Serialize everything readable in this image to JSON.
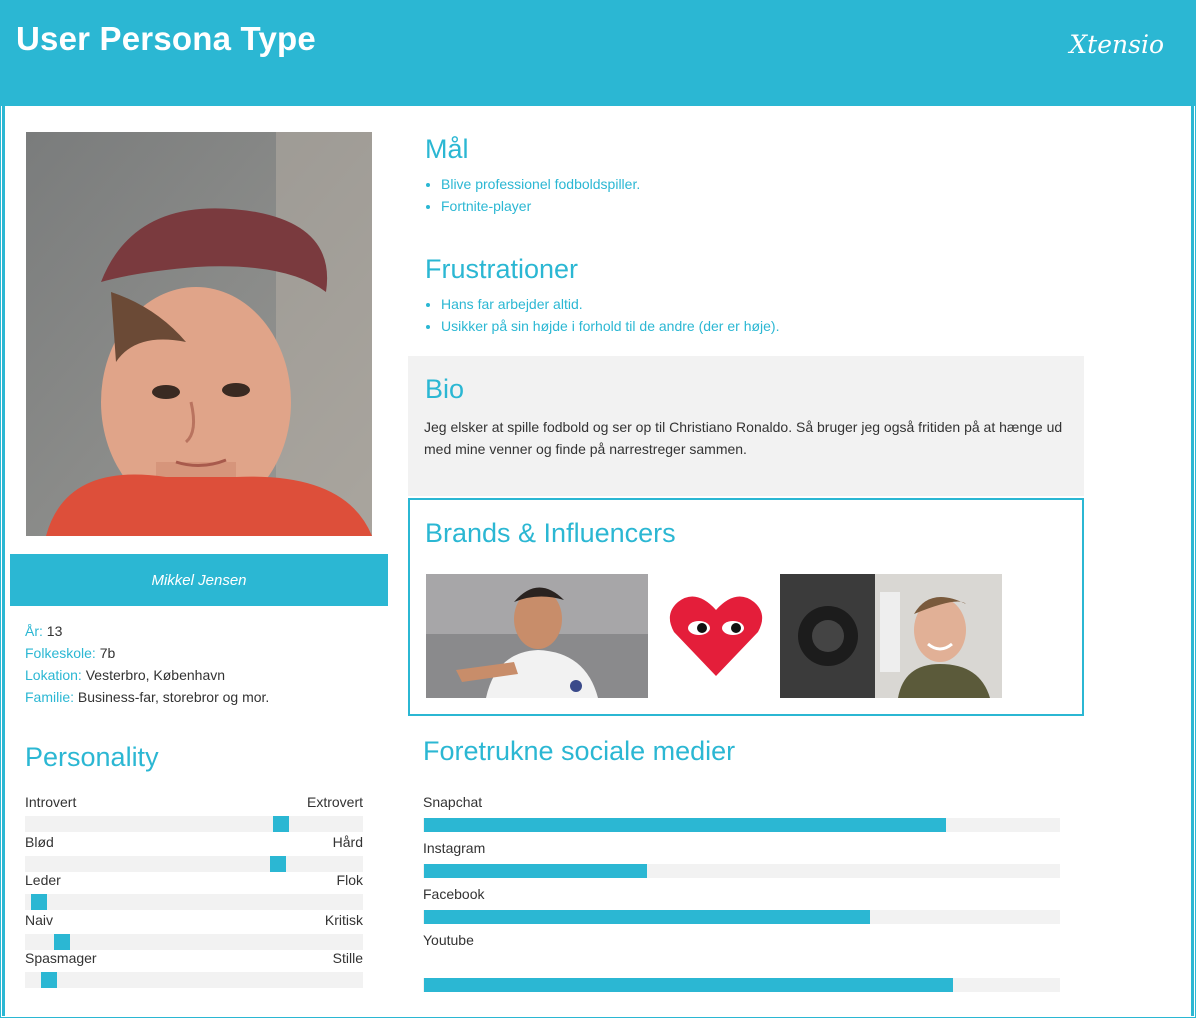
{
  "header": {
    "title": "User Persona Type",
    "logo_text": "Xtensio"
  },
  "persona": {
    "name": "Mikkel Jensen",
    "facts": [
      {
        "key": "År:",
        "value": " 13"
      },
      {
        "key": "Folkeskole:",
        "value": " 7b"
      },
      {
        "key": "Lokation:",
        "value": " Vesterbro, København"
      },
      {
        "key": "Familie:",
        "value": " Business-far, storebror og mor."
      }
    ]
  },
  "personality": {
    "title": "Personality",
    "traits": [
      {
        "left": "Introvert",
        "right": "Extrovert",
        "level": 0.77
      },
      {
        "left": "Blød",
        "right": "Hård",
        "level": 0.76
      },
      {
        "left": "Leder",
        "right": "Flok",
        "level": 0.02
      },
      {
        "left": "Naiv",
        "right": "Kritisk",
        "level": 0.09
      },
      {
        "left": "Spasmager",
        "right": "Stille",
        "level": 0.05
      }
    ]
  },
  "goals": {
    "title": "Mål",
    "items": [
      "Blive professionel fodboldspiller.",
      "Fortnite-player"
    ]
  },
  "frustrations": {
    "title": "Frustrationer",
    "items": [
      "Hans far arbejder altid.",
      "Usikker på sin højde i forhold til de andre (der er høje)."
    ]
  },
  "bio": {
    "title": "Bio",
    "text": "Jeg elsker at spille fodbold og ser op til Christiano Ronaldo. Så bruger jeg også fritiden på at hænge ud med mine venner og finde på narrestreger sammen."
  },
  "brands": {
    "title": "Brands & Influencers"
  },
  "social": {
    "title": "Foretrukne sociale medier",
    "items": [
      {
        "label": "Snapchat",
        "level": 0.82
      },
      {
        "label": "Instagram",
        "level": 0.35
      },
      {
        "label": "Facebook",
        "level": 0.7
      },
      {
        "label": "Youtube",
        "level": 0.83
      }
    ]
  },
  "colors": {
    "accent": "#2bb7d3",
    "track": "#f2f2f2",
    "text": "#333333"
  }
}
